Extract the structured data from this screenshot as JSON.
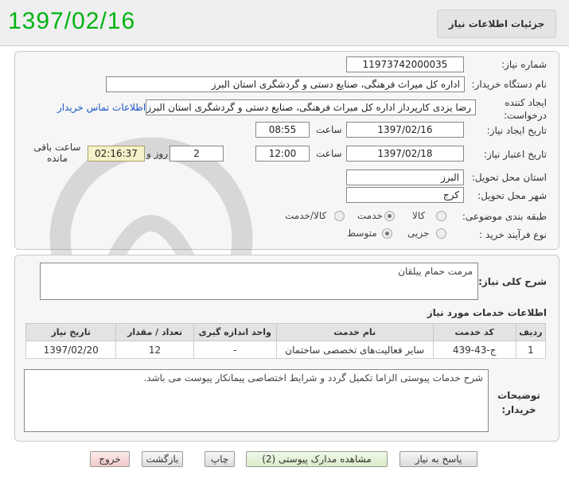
{
  "header": {
    "date_stamp": "1397/02/16",
    "title": "جزئیات اطلاعات نیاز"
  },
  "form": {
    "need_number": {
      "label": "شماره نیاز:",
      "value": "1197374200003​5"
    },
    "buyer": {
      "label": "نام دستگاه خریدار:",
      "value": "اداره کل میراث فرهنگی، صنایع دستی و گردشگری استان البرز"
    },
    "creator": {
      "label": "ایجاد کننده درخواست:",
      "value": "رضا  یزدی کارپرداز اداره کل میراث فرهنگی، صنایع دستی و گردشگری استان البرز",
      "contact_link": "اطلاعات تماس خریدار"
    },
    "created": {
      "label": "تاریخ ایجاد نیاز:",
      "date": "1397/02/16",
      "time_label": "ساعت",
      "time": "08:55"
    },
    "validity": {
      "label": "تاریخ اعتبار نیاز:",
      "date": "1397/02/18",
      "time_label": "ساعت",
      "time": "12:00",
      "days": "2",
      "days_label": "روز و",
      "remaining": "02:16:37",
      "remaining_label": "ساعت باقی مانده"
    },
    "province": {
      "label": "استان محل تحویل:",
      "value": "البرز"
    },
    "city": {
      "label": "شهر محل تحویل:",
      "value": "کرج"
    },
    "category": {
      "label": "طبقه بندی موضوعی:",
      "options": [
        "کالا",
        "خدمت",
        "کالا/خدمت"
      ],
      "selected": "خدمت"
    },
    "process": {
      "label": "نوع فرآیند خرید :",
      "options": [
        "جزیی",
        "متوسط"
      ],
      "selected": "متوسط"
    }
  },
  "summary": {
    "label": "شرح کلی نیاز:",
    "value": "مرمت حمام ییلقان"
  },
  "services": {
    "title": "اطلاعات خدمات مورد نیاز",
    "columns": [
      "ردیف",
      "کد خدمت",
      "نام خدمت",
      "واحد اندازه گیری",
      "تعداد / مقدار",
      "تاریخ نیاز"
    ],
    "rows": [
      {
        "index": "1",
        "code": "ج-43-439",
        "name": "سایر فعالیت‌های تخصصی ساختمان",
        "unit": "-",
        "qty": "12",
        "date": "1397/02/20"
      }
    ]
  },
  "notes": {
    "label": "توضیحات خریدار:",
    "value": "شرح خدمات پیوستی الزاما تکمیل گردد و شرایط اختصاصی پیمانکار پیوست می باشد."
  },
  "buttons": {
    "reply": "پاسخ به نیاز",
    "docs": "مشاهده مدارک پیوستی (2)",
    "print": "چاپ",
    "back": "بازگشت",
    "exit": "خروج"
  }
}
